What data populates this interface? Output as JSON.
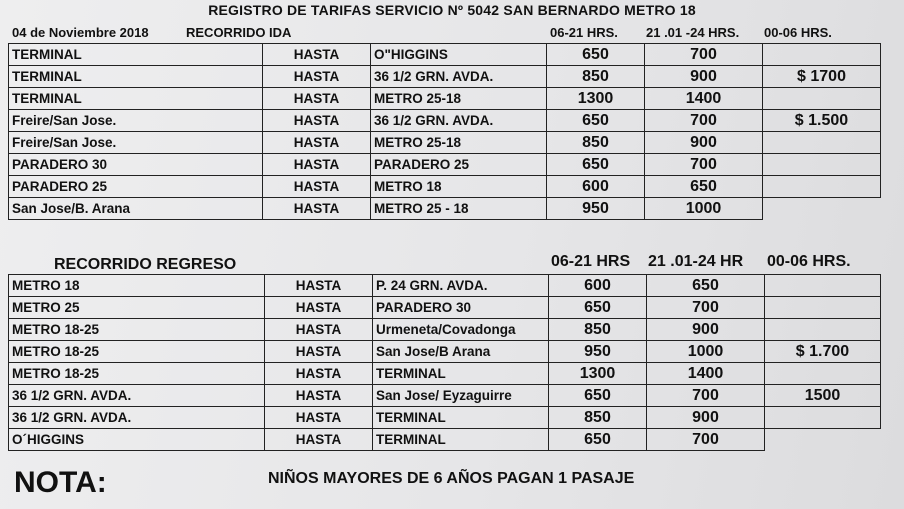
{
  "title": "REGISTRO DE TARIFAS SERVICIO Nº 5042 SAN BERNARDO METRO 18",
  "date": "04 de Noviembre 2018",
  "ida": {
    "label": "RECORRIDO IDA",
    "headers": [
      "06-21 HRS.",
      "21 .01 -24 HRS.",
      "00-06 HRS."
    ],
    "rows": [
      {
        "from": "TERMINAL",
        "hasta": "HASTA",
        "to": "O\"HIGGINS",
        "day": "650",
        "eve": "700",
        "night": ""
      },
      {
        "from": "TERMINAL",
        "hasta": "HASTA",
        "to": "36 1/2 GRN. AVDA.",
        "day": "850",
        "eve": "900",
        "night": "$ 1700"
      },
      {
        "from": "TERMINAL",
        "hasta": "HASTA",
        "to": "METRO 25-18",
        "day": "1300",
        "eve": "1400",
        "night": ""
      },
      {
        "from": "Freire/San Jose.",
        "hasta": "HASTA",
        "to": "36 1/2 GRN. AVDA.",
        "day": "650",
        "eve": "700",
        "night": "$ 1.500"
      },
      {
        "from": "Freire/San Jose.",
        "hasta": "HASTA",
        "to": "METRO 25-18",
        "day": "850",
        "eve": "900",
        "night": ""
      },
      {
        "from": "PARADERO 30",
        "hasta": "HASTA",
        "to": "PARADERO 25",
        "day": "650",
        "eve": "700",
        "night": ""
      },
      {
        "from": "PARADERO 25",
        "hasta": "HASTA",
        "to": "METRO 18",
        "day": "600",
        "eve": "650",
        "night": ""
      },
      {
        "from": "San Jose/B. Arana",
        "hasta": "HASTA",
        "to": "METRO 25 - 18",
        "day": "950",
        "eve": "1000",
        "night": ""
      }
    ]
  },
  "regreso": {
    "label": "RECORRIDO REGRESO",
    "headers": [
      "06-21 HRS",
      "21 .01-24 HR",
      "00-06 HRS."
    ],
    "rows": [
      {
        "from": "METRO 18",
        "hasta": "HASTA",
        "to": "P. 24 GRN. AVDA.",
        "day": "600",
        "eve": "650",
        "night": ""
      },
      {
        "from": "METRO 25",
        "hasta": "HASTA",
        "to": "PARADERO 30",
        "day": "650",
        "eve": "700",
        "night": ""
      },
      {
        "from": "METRO 18-25",
        "hasta": "HASTA",
        "to": "Urmeneta/Covadonga",
        "day": "850",
        "eve": "900",
        "night": ""
      },
      {
        "from": "METRO 18-25",
        "hasta": "HASTA",
        "to": "San Jose/B Arana",
        "day": "950",
        "eve": "1000",
        "night": "$ 1.700"
      },
      {
        "from": "METRO 18-25",
        "hasta": "HASTA",
        "to": "TERMINAL",
        "day": "1300",
        "eve": "1400",
        "night": ""
      },
      {
        "from": "36 1/2 GRN. AVDA.",
        "hasta": "HASTA",
        "to": "San Jose/ Eyzaguirre",
        "day": "650",
        "eve": "700",
        "night": "1500"
      },
      {
        "from": "36 1/2 GRN. AVDA.",
        "hasta": "HASTA",
        "to": "TERMINAL",
        "day": "850",
        "eve": "900",
        "night": ""
      },
      {
        "from": "O´HIGGINS",
        "hasta": "HASTA",
        "to": "TERMINAL",
        "day": "650",
        "eve": "700",
        "night": ""
      }
    ]
  },
  "note": {
    "label": "NOTA:",
    "text": "NIÑOS MAYORES DE 6 AÑOS PAGAN 1 PASAJE"
  }
}
